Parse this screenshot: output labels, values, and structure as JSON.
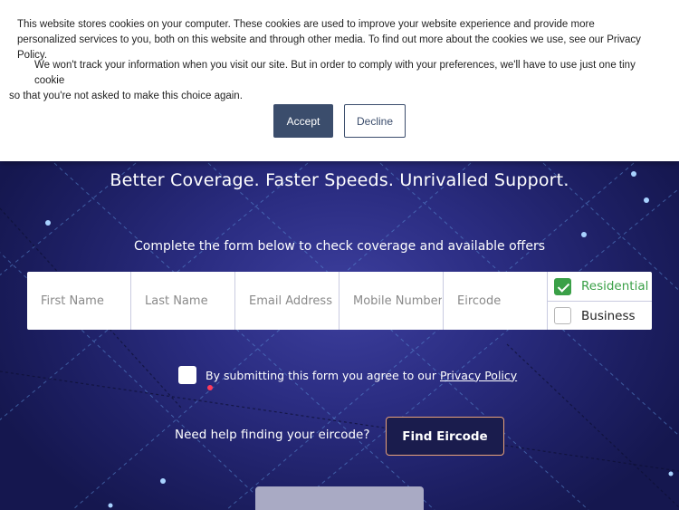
{
  "cookie_banner": {
    "text_1": "This website stores cookies on your computer. These cookies are used to improve your website experience and provide more personalized services to you, both on this website and through other media. To find out more about the cookies we use, see our Privacy Policy.",
    "text_2_line1": "We won't track your information when you visit our site. But in order to comply with your preferences, we'll have to use just one tiny cookie",
    "text_2_line2": "so that you're not asked to make this choice again.",
    "accept_label": "Accept",
    "decline_label": "Decline"
  },
  "hero": {
    "headline": "Better Coverage. Faster Speeds. Unrivalled Support.",
    "subline": "Complete the form below to check coverage and available offers"
  },
  "form": {
    "first_name": {
      "placeholder": "First Name",
      "value": ""
    },
    "last_name": {
      "placeholder": "Last Name",
      "value": ""
    },
    "email": {
      "placeholder": "Email Address",
      "value": ""
    },
    "mobile": {
      "placeholder": "Mobile Number",
      "value": ""
    },
    "eircode": {
      "placeholder": "Eircode",
      "value": ""
    },
    "type_options": [
      {
        "label": "Residential",
        "checked": true
      },
      {
        "label": "Business",
        "checked": false
      }
    ],
    "consent_text": "By submitting this form you agree to our",
    "consent_link": "Privacy Policy",
    "eircode_help": "Need help finding your eircode?",
    "find_eircode_label": "Find Eircode"
  },
  "colors": {
    "accent_green": "#3aa047",
    "cookie_button": "#3b4d6c",
    "hero_bg": "#1b1d5c",
    "find_button_border": "#e8a27a"
  }
}
